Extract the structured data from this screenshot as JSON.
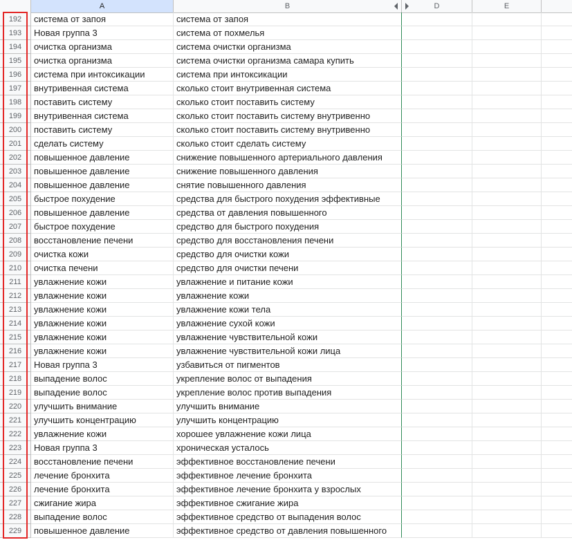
{
  "columns": {
    "a": "A",
    "b": "B",
    "d": "D",
    "e": "E"
  },
  "rows": [
    {
      "n": "192",
      "a": "система от запоя",
      "b": "система от запоя"
    },
    {
      "n": "193",
      "a": "Новая группа 3",
      "b": "система от похмелья"
    },
    {
      "n": "194",
      "a": "очистка организма",
      "b": "система очистки организма"
    },
    {
      "n": "195",
      "a": "очистка организма",
      "b": "система очистки организма самара купить"
    },
    {
      "n": "196",
      "a": "система при интоксикации",
      "b": "система при интоксикации"
    },
    {
      "n": "197",
      "a": "внутривенная система",
      "b": "сколько стоит внутривенная система"
    },
    {
      "n": "198",
      "a": "поставить систему",
      "b": "сколько стоит поставить систему"
    },
    {
      "n": "199",
      "a": "внутривенная система",
      "b": "сколько стоит поставить систему внутривенно"
    },
    {
      "n": "200",
      "a": "поставить систему",
      "b": "сколько стоит поставить систему внутривенно"
    },
    {
      "n": "201",
      "a": "сделать систему",
      "b": "сколько стоит сделать систему"
    },
    {
      "n": "202",
      "a": "повышенное давление",
      "b": "снижение повышенного артериального давления"
    },
    {
      "n": "203",
      "a": "повышенное давление",
      "b": "снижение повышенного давления"
    },
    {
      "n": "204",
      "a": "повышенное давление",
      "b": "снятие повышенного давления"
    },
    {
      "n": "205",
      "a": "быстрое похудение",
      "b": "средства для быстрого похудения эффективные"
    },
    {
      "n": "206",
      "a": "повышенное давление",
      "b": "средства от давления повышенного"
    },
    {
      "n": "207",
      "a": "быстрое похудение",
      "b": "средство для быстрого похудения"
    },
    {
      "n": "208",
      "a": "восстановление печени",
      "b": "средство для восстановления печени"
    },
    {
      "n": "209",
      "a": "очистка кожи",
      "b": "средство для очистки кожи"
    },
    {
      "n": "210",
      "a": "очистка печени",
      "b": "средство для очистки печени"
    },
    {
      "n": "211",
      "a": "увлажнение кожи",
      "b": "увлажнение и питание кожи"
    },
    {
      "n": "212",
      "a": "увлажнение кожи",
      "b": "увлажнение кожи"
    },
    {
      "n": "213",
      "a": "увлажнение кожи",
      "b": "увлажнение кожи тела"
    },
    {
      "n": "214",
      "a": "увлажнение кожи",
      "b": "увлажнение сухой кожи"
    },
    {
      "n": "215",
      "a": "увлажнение кожи",
      "b": "увлажнение чувствительной кожи"
    },
    {
      "n": "216",
      "a": "увлажнение кожи",
      "b": "увлажнение чувствительной кожи лица"
    },
    {
      "n": "217",
      "a": "Новая группа 3",
      "b": "узбавиться от пигментов"
    },
    {
      "n": "218",
      "a": "выпадение волос",
      "b": "укрепление волос от выпадения"
    },
    {
      "n": "219",
      "a": "выпадение волос",
      "b": "укрепление волос против выпадения"
    },
    {
      "n": "220",
      "a": "улучшить внимание",
      "b": "улучшить внимание"
    },
    {
      "n": "221",
      "a": "улучшить концентрацию",
      "b": "улучшить концентрацию"
    },
    {
      "n": "222",
      "a": "увлажнение кожи",
      "b": "хорошее увлажнение кожи лица"
    },
    {
      "n": "223",
      "a": "Новая группа 3",
      "b": "хроническая усталось"
    },
    {
      "n": "224",
      "a": "восстановление печени",
      "b": "эффективное восстановление печени"
    },
    {
      "n": "225",
      "a": "лечение бронхита",
      "b": "эффективное лечение бронхита"
    },
    {
      "n": "226",
      "a": "лечение бронхита",
      "b": "эффективное лечение бронхита у взрослых"
    },
    {
      "n": "227",
      "a": "сжигание жира",
      "b": "эффективное сжигание жира"
    },
    {
      "n": "228",
      "a": "выпадение волос",
      "b": "эффективное средство от выпадения волос"
    },
    {
      "n": "229",
      "a": "повышенное давление",
      "b": "эффективное средство от давления повышенного"
    }
  ]
}
